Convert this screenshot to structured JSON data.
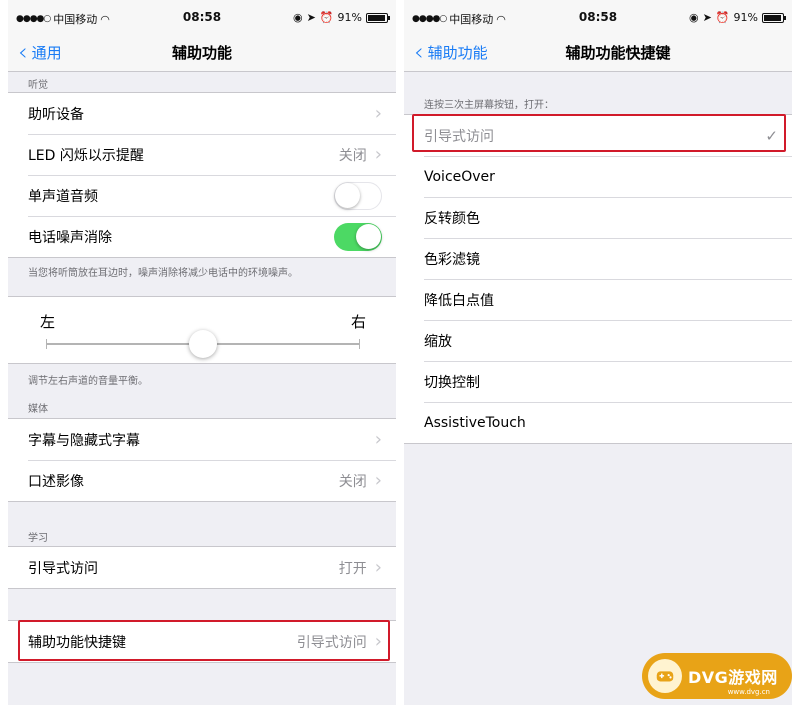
{
  "left_screen": {
    "status": {
      "carrier": "中国移动",
      "time": "08:58",
      "battery": "91%"
    },
    "nav": {
      "back_label": "通用",
      "title": "辅助功能"
    },
    "hearing_header": "听觉",
    "hearing_rows": [
      {
        "label": "助听设备"
      },
      {
        "label": "LED 闪烁以示提醒",
        "value": "关闭"
      },
      {
        "label": "单声道音频",
        "toggle": "off"
      },
      {
        "label": "电话噪声消除",
        "toggle": "on"
      }
    ],
    "noise_footnote": "当您将听筒放在耳边时，噪声消除将减少电话中的环境噪声。",
    "balance": {
      "left_label": "左",
      "right_label": "右",
      "position": 0.5
    },
    "balance_footnote": "调节左右声道的音量平衡。",
    "media_header": "媒体",
    "media_rows": [
      {
        "label": "字幕与隐藏式字幕"
      },
      {
        "label": "口述影像",
        "value": "关闭"
      }
    ],
    "learning_header": "学习",
    "learning_row": {
      "label": "引导式访问",
      "value": "打开"
    },
    "shortcut_row": {
      "label": "辅助功能快捷键",
      "value": "引导式访问"
    }
  },
  "right_screen": {
    "status": {
      "carrier": "中国移动",
      "time": "08:58",
      "battery": "91%"
    },
    "nav": {
      "back_label": "辅助功能",
      "title": "辅助功能快捷键"
    },
    "list_header": "连按三次主屏幕按钮，打开：",
    "options": [
      {
        "label": "引导式访问",
        "selected": true
      },
      {
        "label": "VoiceOver"
      },
      {
        "label": "反转颜色"
      },
      {
        "label": "色彩滤镜"
      },
      {
        "label": "降低白点值"
      },
      {
        "label": "缩放"
      },
      {
        "label": "切换控制"
      },
      {
        "label": "AssistiveTouch"
      }
    ]
  },
  "watermark": {
    "text": "DVG游戏网",
    "sub": "www.dvg.cn"
  },
  "colors": {
    "ios_blue": "#1a7cf5",
    "toggle_on": "#4cd964",
    "highlight_red": "#d11a2a",
    "watermark_orange": "#e8a317"
  }
}
